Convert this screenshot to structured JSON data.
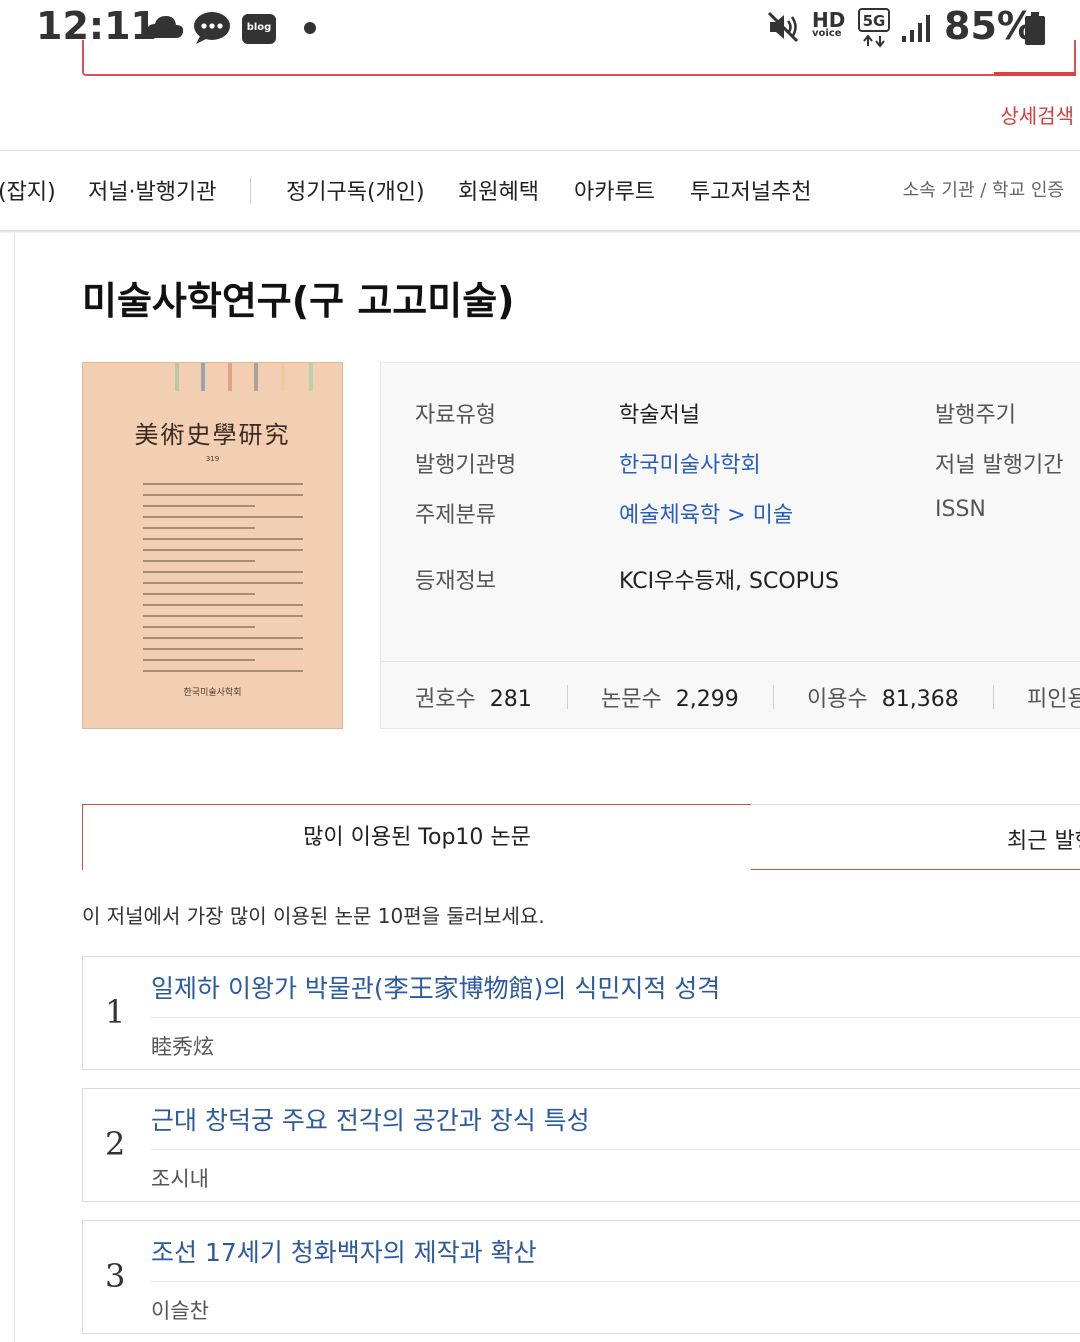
{
  "status_bar": {
    "time": "12:11",
    "blog_label": "blog",
    "hd_label": "HD",
    "voice_label": "voice",
    "network_label": "5G",
    "battery_percent": "85%",
    "icons": [
      "cloud-icon",
      "chat-icon",
      "blog-icon",
      "dot-icon",
      "mute-icon",
      "hd-voice-icon",
      "5g-icon",
      "signal-icon",
      "battery-icon"
    ]
  },
  "header": {
    "advanced_search": "상세검색"
  },
  "nav": {
    "items": [
      "(잡지)",
      "저널·발행기관",
      "정기구독(개인)",
      "회원혜택",
      "아카루트",
      "투고저널추천"
    ],
    "auth": "소속 기관 / 학교 인증"
  },
  "journal": {
    "title": "미술사학연구(구 고고미술)",
    "cover": {
      "title": "美術史學研究",
      "volume": "319",
      "publisher": "한국미술사학회"
    },
    "info": {
      "type_label": "자료유형",
      "type_value": "학술저널",
      "publisher_label": "발행기관명",
      "publisher_value": "한국미술사학회",
      "subject_label": "주제분류",
      "subject_value": "예술체육학 > 미술",
      "listing_label": "등재정보",
      "listing_value": "KCI우수등재, SCOPUS",
      "cycle_label": "발행주기",
      "period_label": "저널 발행기간",
      "issn_label": "ISSN"
    },
    "stats": {
      "issues_label": "권호수",
      "issues_value": "281",
      "papers_label": "논문수",
      "papers_value": "2,299",
      "usage_label": "이용수",
      "usage_value": "81,368",
      "cited_label": "피인용"
    }
  },
  "tabs": {
    "active": "많이 이용된 Top10 논문",
    "inactive": "최근 발행"
  },
  "list": {
    "intro": "이 저널에서 가장 많이 이용된 논문 10편을 둘러보세요.",
    "articles": [
      {
        "num": "1",
        "title": "일제하 이왕가 박물관(李王家博物館)의 식민지적 성격",
        "author": "睦秀炫"
      },
      {
        "num": "2",
        "title": "근대 창덕궁 주요 전각의 공간과 장식 특성",
        "author": "조시내"
      },
      {
        "num": "3",
        "title": "조선 17세기 청화백자의 제작과 확산",
        "author": "이슬찬"
      }
    ]
  },
  "colors": {
    "accent_red": "#d23c3c",
    "link_blue": "#2a5cc4",
    "article_blue": "#2b5aa0",
    "cover_bg": "#f2cfb2"
  }
}
